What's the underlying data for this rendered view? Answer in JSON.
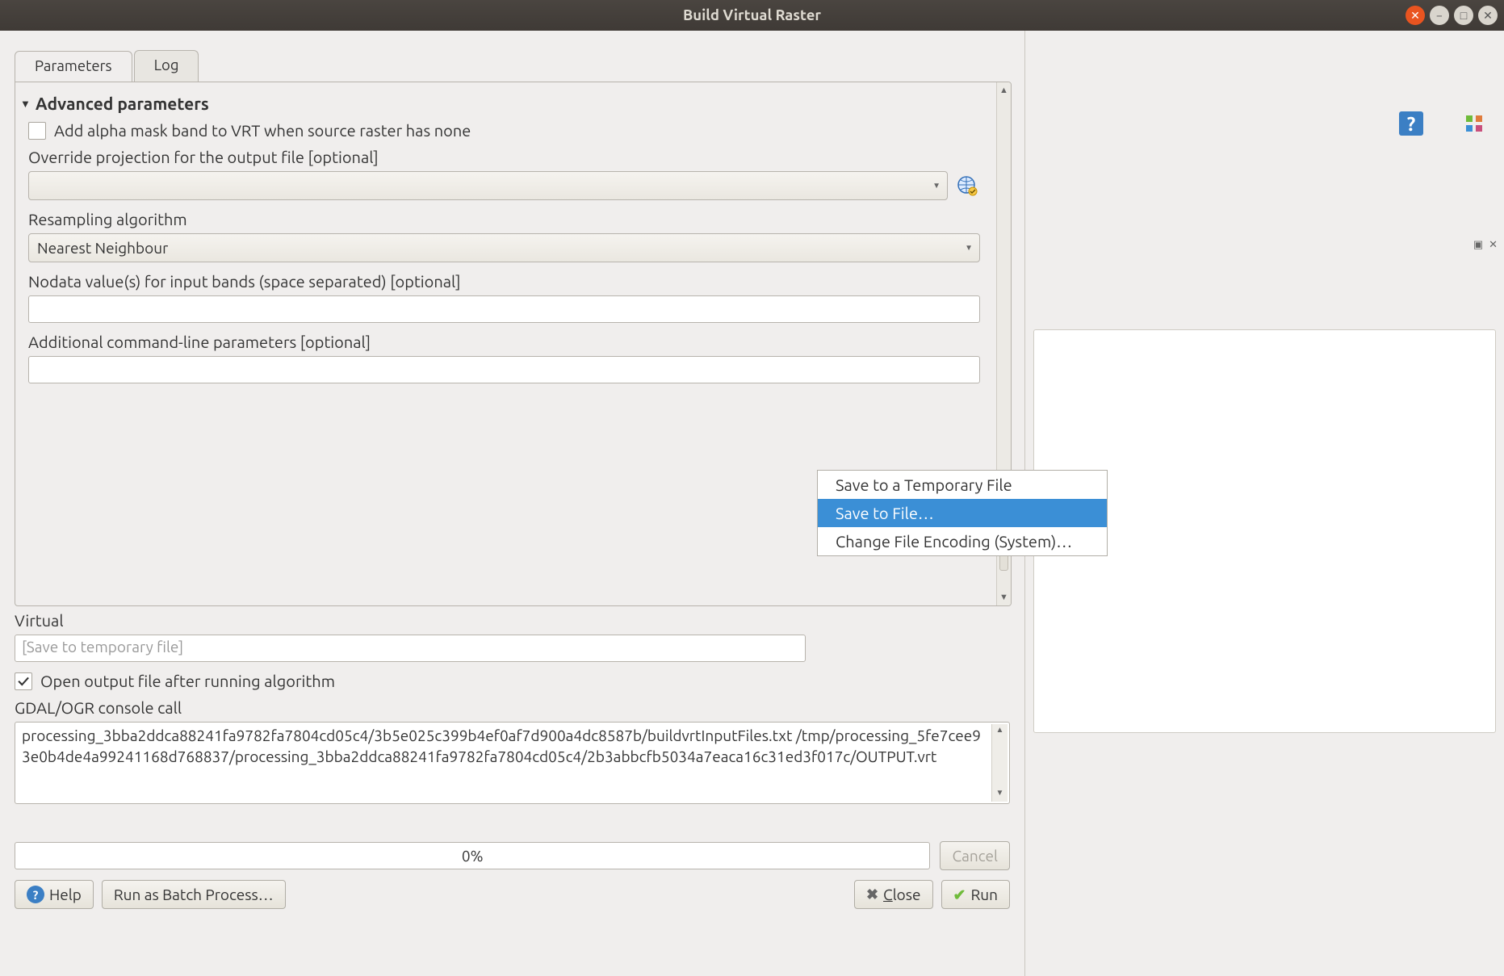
{
  "window": {
    "title": "Build Virtual Raster"
  },
  "tabs": {
    "parameters": "Parameters",
    "log": "Log"
  },
  "adv_header": "Advanced parameters",
  "alpha_mask_label": "Add alpha mask band to VRT when source raster has none",
  "alpha_mask_checked": false,
  "override_proj_label": "Override projection for the output file [optional]",
  "override_proj_value": "",
  "resample_label": "Resampling algorithm",
  "resample_value": "Nearest Neighbour",
  "nodata_label": "Nodata value(s) for input bands (space separated) [optional]",
  "nodata_value": "",
  "addl_cmd_label": "Additional command-line parameters [optional]",
  "addl_cmd_value": "",
  "virtual_label": "Virtual",
  "virtual_placeholder": "[Save to temporary file]",
  "open_output_label": "Open output file after running algorithm",
  "open_output_checked": true,
  "console_label": "GDAL/OGR console call",
  "console_text": "processing_3bba2ddca88241fa9782fa7804cd05c4/3b5e025c399b4ef0af7d900a4dc8587b/buildvrtInputFiles.txt /tmp/processing_5fe7cee93e0b4de4a99241168d768837/processing_3bba2ddca88241fa9782fa7804cd05c4/2b3abbcfb5034a7eaca16c31ed3f017c/OUTPUT.vrt",
  "popup": {
    "save_temp": "Save to a Temporary File",
    "save_file": "Save to File…",
    "change_encoding": "Change File Encoding (System)…"
  },
  "progress": "0%",
  "buttons": {
    "cancel": "Cancel",
    "help": "Help",
    "batch": "Run as Batch Process…",
    "close": "Close",
    "run": "Run"
  }
}
